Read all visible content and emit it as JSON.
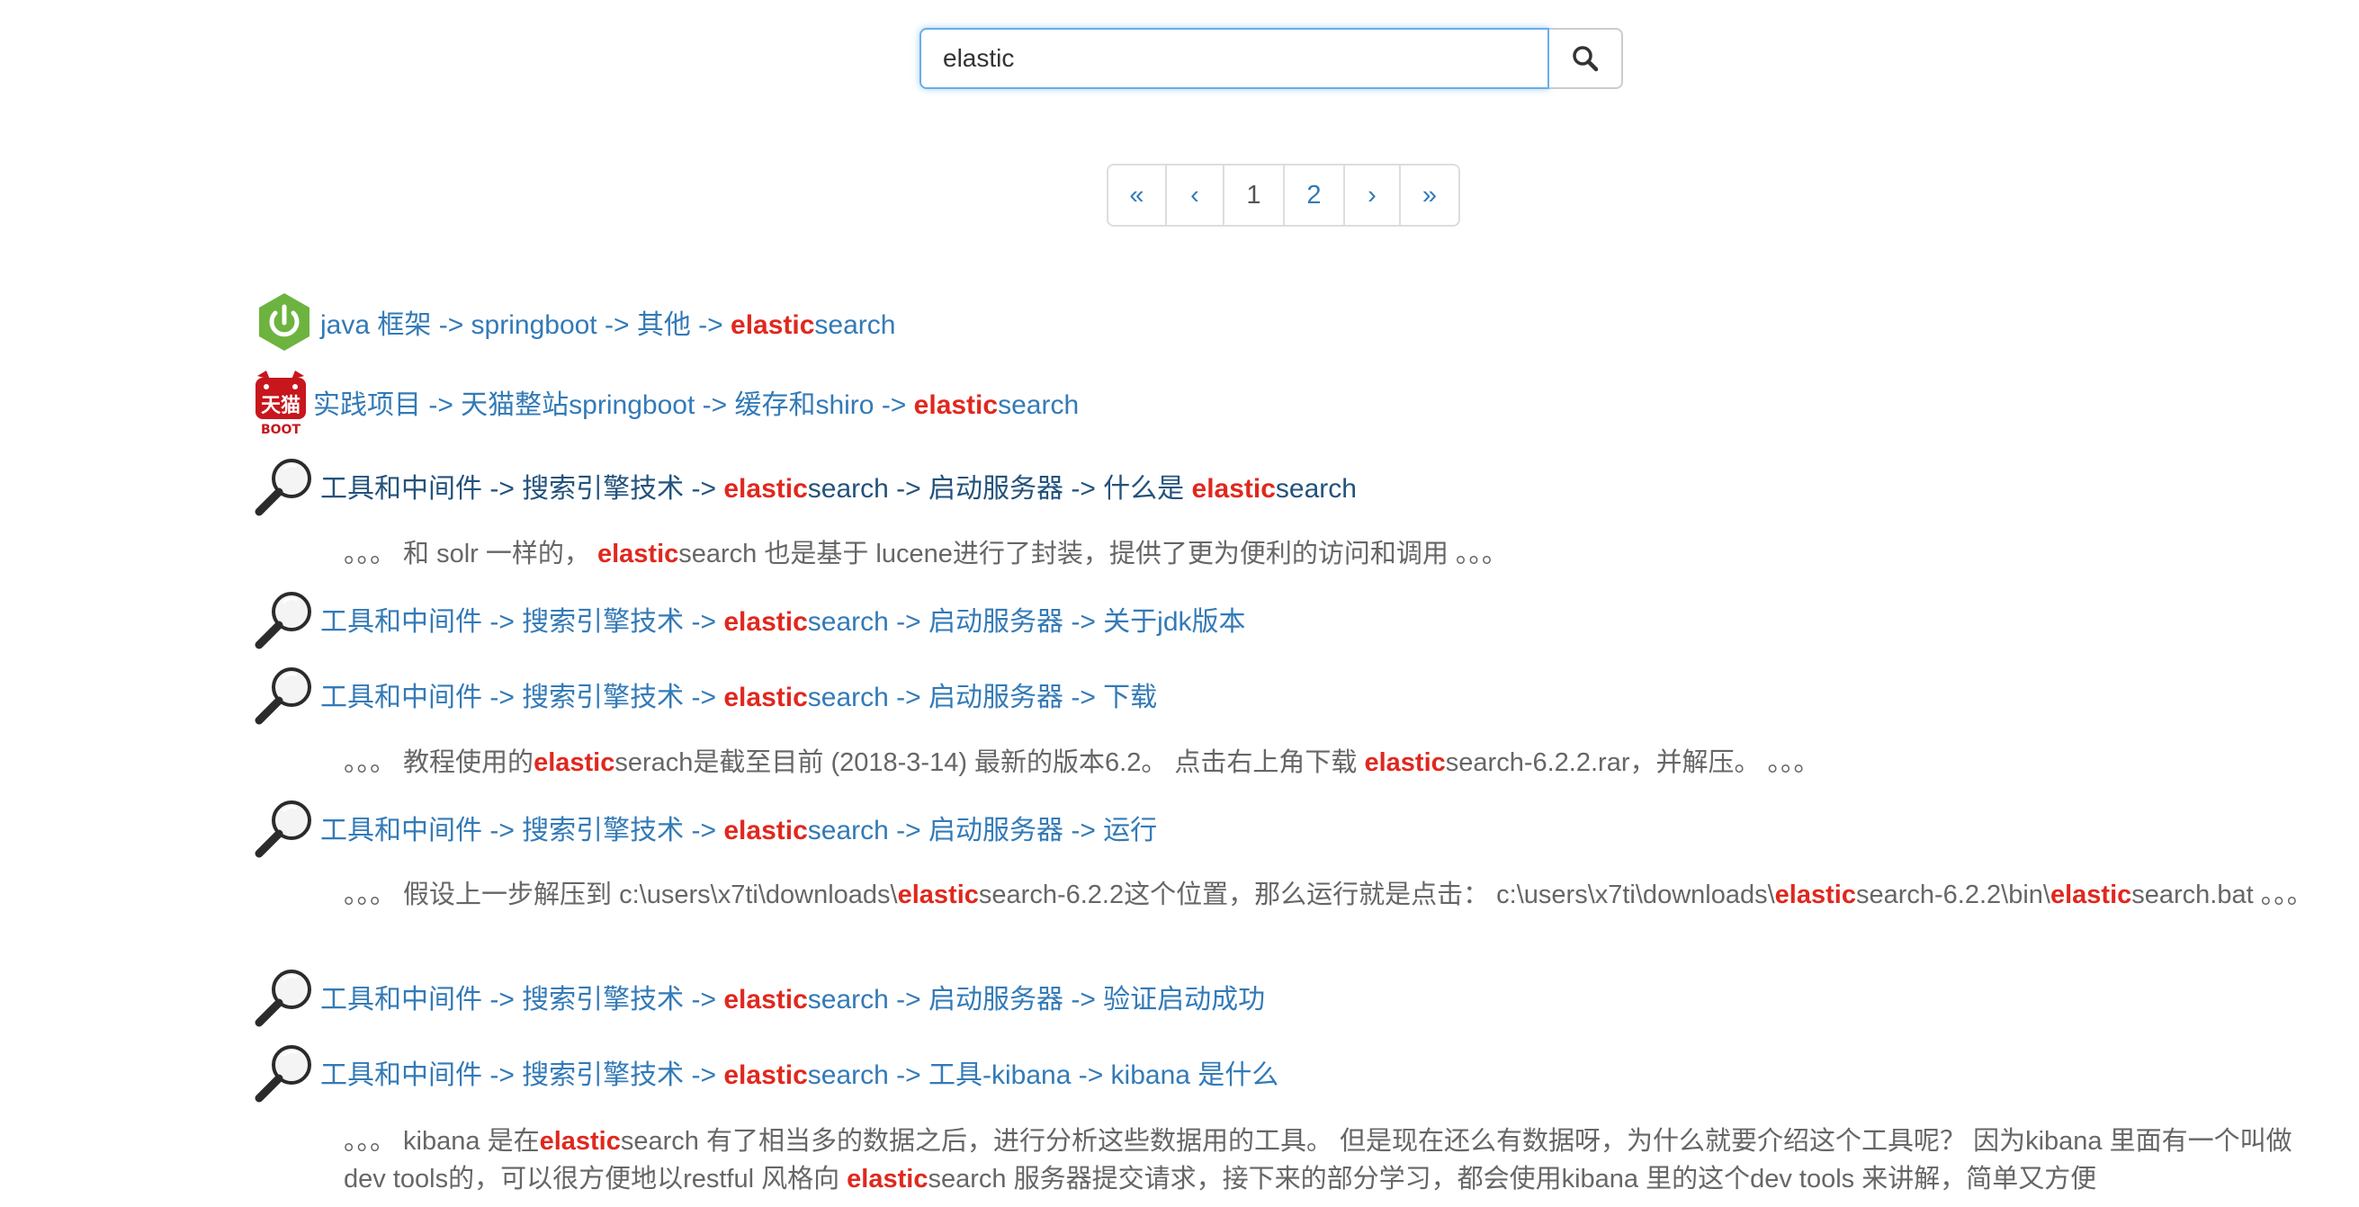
{
  "search": {
    "value": "elastic",
    "button_icon": "search-icon"
  },
  "pagination": {
    "first": "«",
    "prev": "‹",
    "pages": [
      "1",
      "2"
    ],
    "current": "1",
    "next": "›",
    "last": "»"
  },
  "highlight": "elastic",
  "results": [
    {
      "icon": "springboot-power-icon",
      "title": [
        {
          "t": "java 框架 -> springboot -> 其他 -> "
        },
        {
          "t": "elastic",
          "hl": true
        },
        {
          "t": "search"
        }
      ]
    },
    {
      "icon": "tmall-boot-cat-icon",
      "icon_text": "天猫",
      "icon_subtext": "BOOT",
      "title": [
        {
          "t": "实践项目 -> 天猫整站springboot -> 缓存和shiro -> "
        },
        {
          "t": "elastic",
          "hl": true
        },
        {
          "t": "search"
        }
      ]
    },
    {
      "icon": "magnifier-icon",
      "visited": true,
      "title": [
        {
          "t": "工具和中间件 -> 搜索引擎技术 -> "
        },
        {
          "t": "elastic",
          "hl": true
        },
        {
          "t": "search -> 启动服务器 -> 什么是 "
        },
        {
          "t": "elastic",
          "hl": true
        },
        {
          "t": "search"
        }
      ],
      "snippet": [
        {
          "t": "。。。 和 solr 一样的， "
        },
        {
          "t": "elastic",
          "hl": true
        },
        {
          "t": "search 也是基于 lucene进行了封装，提供了更为便利的访问和调用 。。。"
        }
      ]
    },
    {
      "icon": "magnifier-icon",
      "title": [
        {
          "t": "工具和中间件 -> 搜索引擎技术 -> "
        },
        {
          "t": "elastic",
          "hl": true
        },
        {
          "t": "search -> 启动服务器 -> 关于jdk版本"
        }
      ]
    },
    {
      "icon": "magnifier-icon",
      "title": [
        {
          "t": "工具和中间件 -> 搜索引擎技术 -> "
        },
        {
          "t": "elastic",
          "hl": true
        },
        {
          "t": "search -> 启动服务器 -> 下载"
        }
      ],
      "snippet": [
        {
          "t": "。。。 教程使用的"
        },
        {
          "t": "elastic",
          "hl": true
        },
        {
          "t": "serach是截至目前 (2018-3-14) 最新的版本6.2。 点击右上角下载 "
        },
        {
          "t": "elastic",
          "hl": true
        },
        {
          "t": "search-6.2.2.rar，并解压。 。。。"
        }
      ]
    },
    {
      "icon": "magnifier-icon",
      "title": [
        {
          "t": "工具和中间件 -> 搜索引擎技术 -> "
        },
        {
          "t": "elastic",
          "hl": true
        },
        {
          "t": "search -> 启动服务器 -> 运行"
        }
      ],
      "snippet": [
        {
          "t": "。。。 假设上一步解压到 c:\\users\\x7ti\\downloads\\"
        },
        {
          "t": "elastic",
          "hl": true
        },
        {
          "t": "search-6.2.2这个位置，那么运行就是点击： c:\\users\\x7ti\\downloads\\"
        },
        {
          "t": "elastic",
          "hl": true
        },
        {
          "t": "search-6.2.2\\bin\\"
        },
        {
          "t": "elastic",
          "hl": true
        },
        {
          "t": "search.bat 。。。"
        }
      ]
    },
    {
      "icon": "magnifier-icon",
      "title": [
        {
          "t": "工具和中间件 -> 搜索引擎技术 -> "
        },
        {
          "t": "elastic",
          "hl": true
        },
        {
          "t": "search -> 启动服务器 -> 验证启动成功"
        }
      ]
    },
    {
      "icon": "magnifier-icon",
      "title": [
        {
          "t": "工具和中间件 -> 搜索引擎技术 -> "
        },
        {
          "t": "elastic",
          "hl": true
        },
        {
          "t": "search -> 工具-kibana -> kibana 是什么"
        }
      ],
      "snippet": [
        {
          "t": "。。。 kibana 是在"
        },
        {
          "t": "elastic",
          "hl": true
        },
        {
          "t": "search 有了相当多的数据之后，进行分析这些数据用的工具。 但是现在还么有数据呀，为什么就要介绍这个工具呢？ 因为kibana 里面有一个叫做 dev tools的，可以很方便地以restful 风格向 "
        },
        {
          "t": "elastic",
          "hl": true
        },
        {
          "t": "search 服务器提交请求，接下来的部分学习，都会使用kibana 里的这个dev tools 来讲解，简单又方便"
        }
      ]
    }
  ]
}
